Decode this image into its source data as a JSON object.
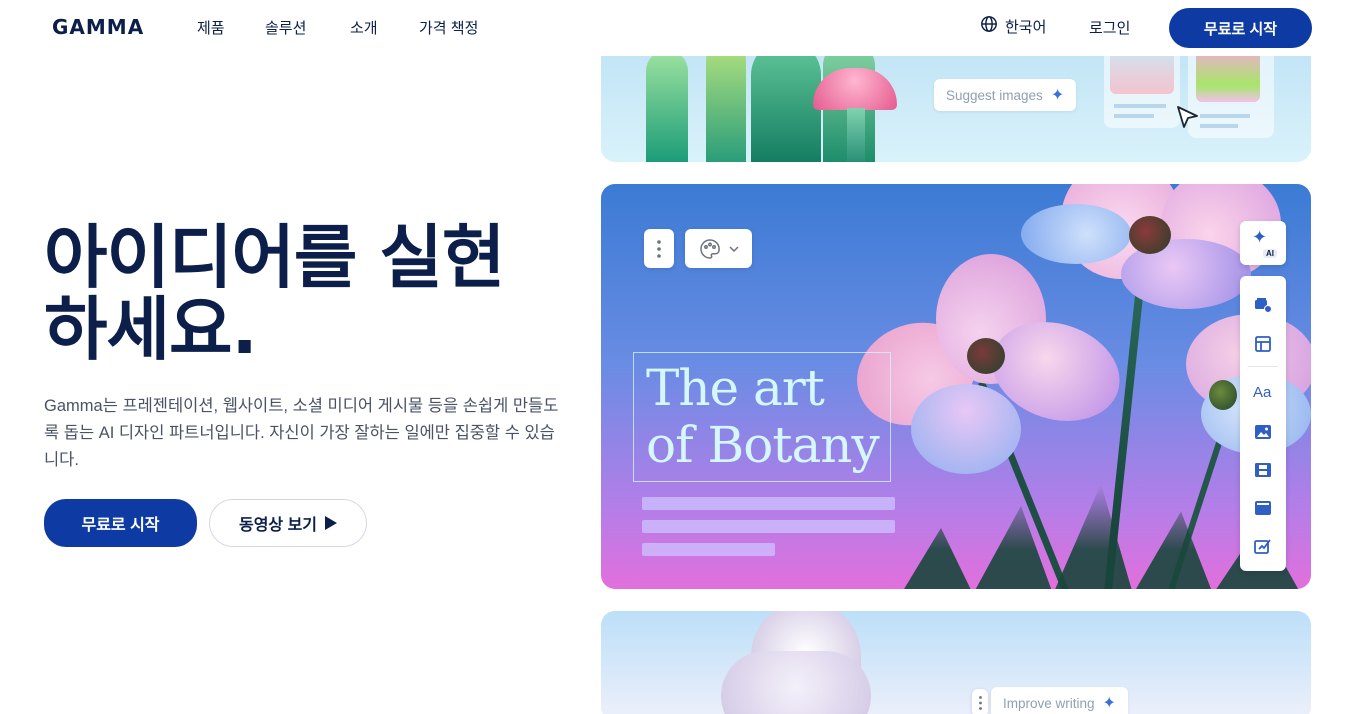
{
  "nav": {
    "logo": "GAMMA",
    "links": [
      "제품",
      "솔루션",
      "소개",
      "가격 책정"
    ],
    "language": "한국어",
    "login": "로그인",
    "cta": "무료로 시작"
  },
  "hero": {
    "headline_line1": "아이디어를 실현",
    "headline_line2": "하세요.",
    "subtitle": "Gamma는 프레젠테이션, 웹사이트, 소셜 미디어 게시물 등을 손쉽게 만들도록 돕는 AI 디자인 파트너입니다. 자신이 가장 잘하는 일에만 집중할 수 있습니다.",
    "cta_primary": "무료로 시작",
    "cta_video": "동영상 보기"
  },
  "visual": {
    "suggest_chip": "Suggest images",
    "improve_chip": "Improve writing",
    "art_title_line1": "The art",
    "art_title_line2": "of Botany",
    "ai_badge": "AI",
    "toolbar_text_icon": "Aa"
  },
  "colors": {
    "navy": "#0b1f4a",
    "brand_blue": "#0d3aa3",
    "accent_blue": "#2f5fc4"
  },
  "icons": [
    "globe-icon",
    "play-icon",
    "sparkle-icon",
    "kebab-icon",
    "palette-icon",
    "chevron-down-icon",
    "cursor-icon",
    "card-add-icon",
    "layout-icon",
    "text-icon",
    "image-icon",
    "video-icon",
    "embed-icon",
    "edit-icon"
  ]
}
